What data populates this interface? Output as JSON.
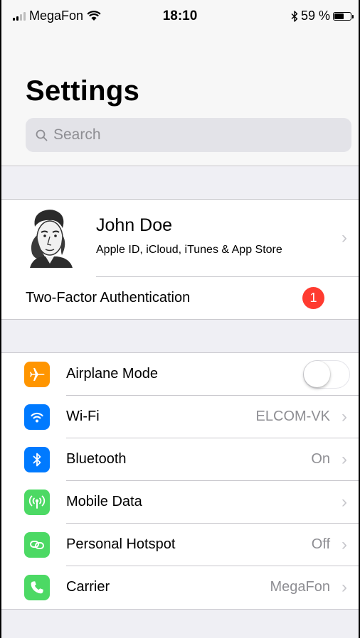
{
  "status_bar": {
    "carrier": "MegaFon",
    "time": "18:10",
    "battery": "59 %",
    "battery_level": 0.59,
    "signal_bars_filled": 2,
    "signal_bars_total": 4
  },
  "header": {
    "title": "Settings",
    "search_placeholder": "Search"
  },
  "profile": {
    "name": "John Doe",
    "subtitle": "Apple ID, iCloud, iTunes & App Store"
  },
  "two_factor": {
    "label": "Two-Factor Authentication",
    "badge_count": "1"
  },
  "settings": [
    {
      "label": "Airplane Mode",
      "icon": "airplane-icon",
      "color": "#ff9500",
      "toggle_on": false
    },
    {
      "label": "Wi-Fi",
      "value": "ELCOM-VK",
      "icon": "wifi-icon",
      "color": "#007aff"
    },
    {
      "label": "Bluetooth",
      "value": "On",
      "icon": "bluetooth-icon",
      "color": "#007aff"
    },
    {
      "label": "Mobile Data",
      "value": "",
      "icon": "antenna-icon",
      "color": "#4cd964"
    },
    {
      "label": "Personal Hotspot",
      "value": "Off",
      "icon": "hotspot-icon",
      "color": "#4cd964"
    },
    {
      "label": "Carrier",
      "value": "MegaFon",
      "icon": "phone-icon",
      "color": "#4cd964"
    }
  ],
  "colors": {
    "badge_red": "#ff3b30",
    "chevron_gray": "#c7c7cc",
    "secondary_text": "#8e8e93",
    "background": "#efeff4"
  }
}
